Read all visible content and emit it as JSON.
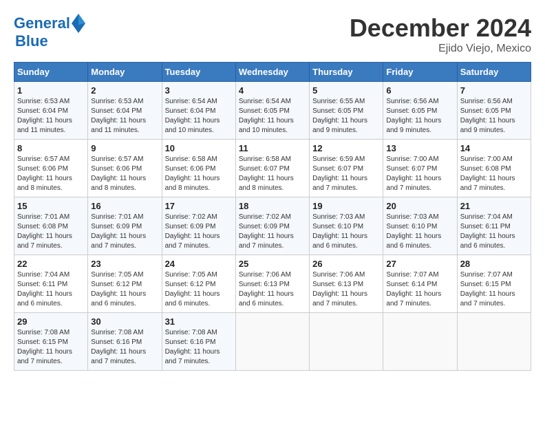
{
  "header": {
    "logo_line1": "General",
    "logo_line2": "Blue",
    "month": "December 2024",
    "location": "Ejido Viejo, Mexico"
  },
  "weekdays": [
    "Sunday",
    "Monday",
    "Tuesday",
    "Wednesday",
    "Thursday",
    "Friday",
    "Saturday"
  ],
  "weeks": [
    [
      {
        "day": "1",
        "info": "Sunrise: 6:53 AM\nSunset: 6:04 PM\nDaylight: 11 hours and 11 minutes."
      },
      {
        "day": "2",
        "info": "Sunrise: 6:53 AM\nSunset: 6:04 PM\nDaylight: 11 hours and 11 minutes."
      },
      {
        "day": "3",
        "info": "Sunrise: 6:54 AM\nSunset: 6:04 PM\nDaylight: 11 hours and 10 minutes."
      },
      {
        "day": "4",
        "info": "Sunrise: 6:54 AM\nSunset: 6:05 PM\nDaylight: 11 hours and 10 minutes."
      },
      {
        "day": "5",
        "info": "Sunrise: 6:55 AM\nSunset: 6:05 PM\nDaylight: 11 hours and 9 minutes."
      },
      {
        "day": "6",
        "info": "Sunrise: 6:56 AM\nSunset: 6:05 PM\nDaylight: 11 hours and 9 minutes."
      },
      {
        "day": "7",
        "info": "Sunrise: 6:56 AM\nSunset: 6:05 PM\nDaylight: 11 hours and 9 minutes."
      }
    ],
    [
      {
        "day": "8",
        "info": "Sunrise: 6:57 AM\nSunset: 6:06 PM\nDaylight: 11 hours and 8 minutes."
      },
      {
        "day": "9",
        "info": "Sunrise: 6:57 AM\nSunset: 6:06 PM\nDaylight: 11 hours and 8 minutes."
      },
      {
        "day": "10",
        "info": "Sunrise: 6:58 AM\nSunset: 6:06 PM\nDaylight: 11 hours and 8 minutes."
      },
      {
        "day": "11",
        "info": "Sunrise: 6:58 AM\nSunset: 6:07 PM\nDaylight: 11 hours and 8 minutes."
      },
      {
        "day": "12",
        "info": "Sunrise: 6:59 AM\nSunset: 6:07 PM\nDaylight: 11 hours and 7 minutes."
      },
      {
        "day": "13",
        "info": "Sunrise: 7:00 AM\nSunset: 6:07 PM\nDaylight: 11 hours and 7 minutes."
      },
      {
        "day": "14",
        "info": "Sunrise: 7:00 AM\nSunset: 6:08 PM\nDaylight: 11 hours and 7 minutes."
      }
    ],
    [
      {
        "day": "15",
        "info": "Sunrise: 7:01 AM\nSunset: 6:08 PM\nDaylight: 11 hours and 7 minutes."
      },
      {
        "day": "16",
        "info": "Sunrise: 7:01 AM\nSunset: 6:09 PM\nDaylight: 11 hours and 7 minutes."
      },
      {
        "day": "17",
        "info": "Sunrise: 7:02 AM\nSunset: 6:09 PM\nDaylight: 11 hours and 7 minutes."
      },
      {
        "day": "18",
        "info": "Sunrise: 7:02 AM\nSunset: 6:09 PM\nDaylight: 11 hours and 7 minutes."
      },
      {
        "day": "19",
        "info": "Sunrise: 7:03 AM\nSunset: 6:10 PM\nDaylight: 11 hours and 6 minutes."
      },
      {
        "day": "20",
        "info": "Sunrise: 7:03 AM\nSunset: 6:10 PM\nDaylight: 11 hours and 6 minutes."
      },
      {
        "day": "21",
        "info": "Sunrise: 7:04 AM\nSunset: 6:11 PM\nDaylight: 11 hours and 6 minutes."
      }
    ],
    [
      {
        "day": "22",
        "info": "Sunrise: 7:04 AM\nSunset: 6:11 PM\nDaylight: 11 hours and 6 minutes."
      },
      {
        "day": "23",
        "info": "Sunrise: 7:05 AM\nSunset: 6:12 PM\nDaylight: 11 hours and 6 minutes."
      },
      {
        "day": "24",
        "info": "Sunrise: 7:05 AM\nSunset: 6:12 PM\nDaylight: 11 hours and 6 minutes."
      },
      {
        "day": "25",
        "info": "Sunrise: 7:06 AM\nSunset: 6:13 PM\nDaylight: 11 hours and 6 minutes."
      },
      {
        "day": "26",
        "info": "Sunrise: 7:06 AM\nSunset: 6:13 PM\nDaylight: 11 hours and 7 minutes."
      },
      {
        "day": "27",
        "info": "Sunrise: 7:07 AM\nSunset: 6:14 PM\nDaylight: 11 hours and 7 minutes."
      },
      {
        "day": "28",
        "info": "Sunrise: 7:07 AM\nSunset: 6:15 PM\nDaylight: 11 hours and 7 minutes."
      }
    ],
    [
      {
        "day": "29",
        "info": "Sunrise: 7:08 AM\nSunset: 6:15 PM\nDaylight: 11 hours and 7 minutes."
      },
      {
        "day": "30",
        "info": "Sunrise: 7:08 AM\nSunset: 6:16 PM\nDaylight: 11 hours and 7 minutes."
      },
      {
        "day": "31",
        "info": "Sunrise: 7:08 AM\nSunset: 6:16 PM\nDaylight: 11 hours and 7 minutes."
      },
      null,
      null,
      null,
      null
    ]
  ]
}
